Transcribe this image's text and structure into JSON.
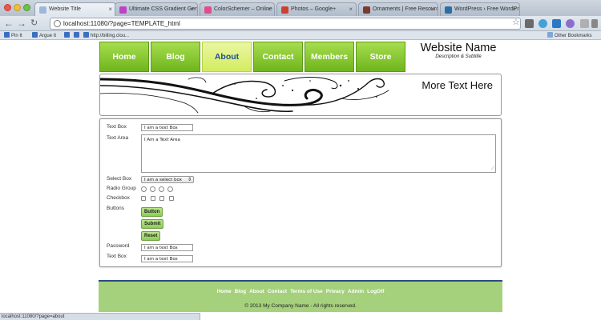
{
  "browser": {
    "tabs": [
      {
        "label": "Website Title",
        "active": true,
        "favicon_color": "#9fb7d8"
      },
      {
        "label": "Ultimate CSS Gradient Gene",
        "active": false,
        "favicon_color": "#c040c8"
      },
      {
        "label": "ColorSchemer – Online Colo",
        "active": false,
        "favicon_color": "#e14d8c"
      },
      {
        "label": "Photos – Google+",
        "active": false,
        "favicon_color": "#d0402f"
      },
      {
        "label": "Ornaments | Free Resource",
        "active": false,
        "favicon_color": "#7a3a2e"
      },
      {
        "label": "WordPress › Free WordPress",
        "active": false,
        "favicon_color": "#2b6ea5"
      }
    ],
    "url": "localhost:11080/?page=TEMPLATE_html",
    "bookmarks": [
      {
        "label": "Pin It"
      },
      {
        "label": "Argue It"
      },
      {
        "label": "http://billing.clou..."
      }
    ],
    "other_bookmarks": "Other Bookmarks",
    "status_url": "localhost:11080/?page=about",
    "back_icon": "arrow-left-icon",
    "forward_icon": "arrow-right-icon",
    "reload_icon": "reload-icon",
    "star_icon": "star-icon"
  },
  "site": {
    "nav": [
      {
        "label": "Home",
        "active": false
      },
      {
        "label": "Blog",
        "active": false
      },
      {
        "label": "About",
        "active": true
      },
      {
        "label": "Contact",
        "active": false
      },
      {
        "label": "Members",
        "active": false
      },
      {
        "label": "Store",
        "active": false
      }
    ],
    "name": "Website Name",
    "subtitle": "Description & Subtitle",
    "banner_text": "More Text Here",
    "colors": {
      "nav_green": "#8ccc3a",
      "nav_active": "#dff283",
      "footer_green": "#a5d17c",
      "footer_border": "#2d4b86"
    }
  },
  "form": {
    "textbox1": {
      "label": "Text Box",
      "value": "I am a text Box"
    },
    "textarea": {
      "label": "Text Area",
      "value": "I Am a Text Area"
    },
    "select": {
      "label": "Select Box",
      "value": "I am a select box"
    },
    "radio": {
      "label": "Radio Group",
      "count": 4
    },
    "checkbox": {
      "label": "Checkbox",
      "count": 4
    },
    "buttons": {
      "label": "Buttons",
      "button": "Button",
      "submit": "Submit",
      "reset": "Reset"
    },
    "password": {
      "label": "Password",
      "value": "I am a text Box"
    },
    "textbox2": {
      "label": "Text Box",
      "value": "I am a text Box"
    }
  },
  "footer": {
    "links": [
      "Home",
      "Blog",
      "About",
      "Contact",
      "Terms of Use",
      "Privacy",
      "Admin",
      "LogOff"
    ],
    "copyright": "© 2013 My Company Name - All rights reserved."
  }
}
